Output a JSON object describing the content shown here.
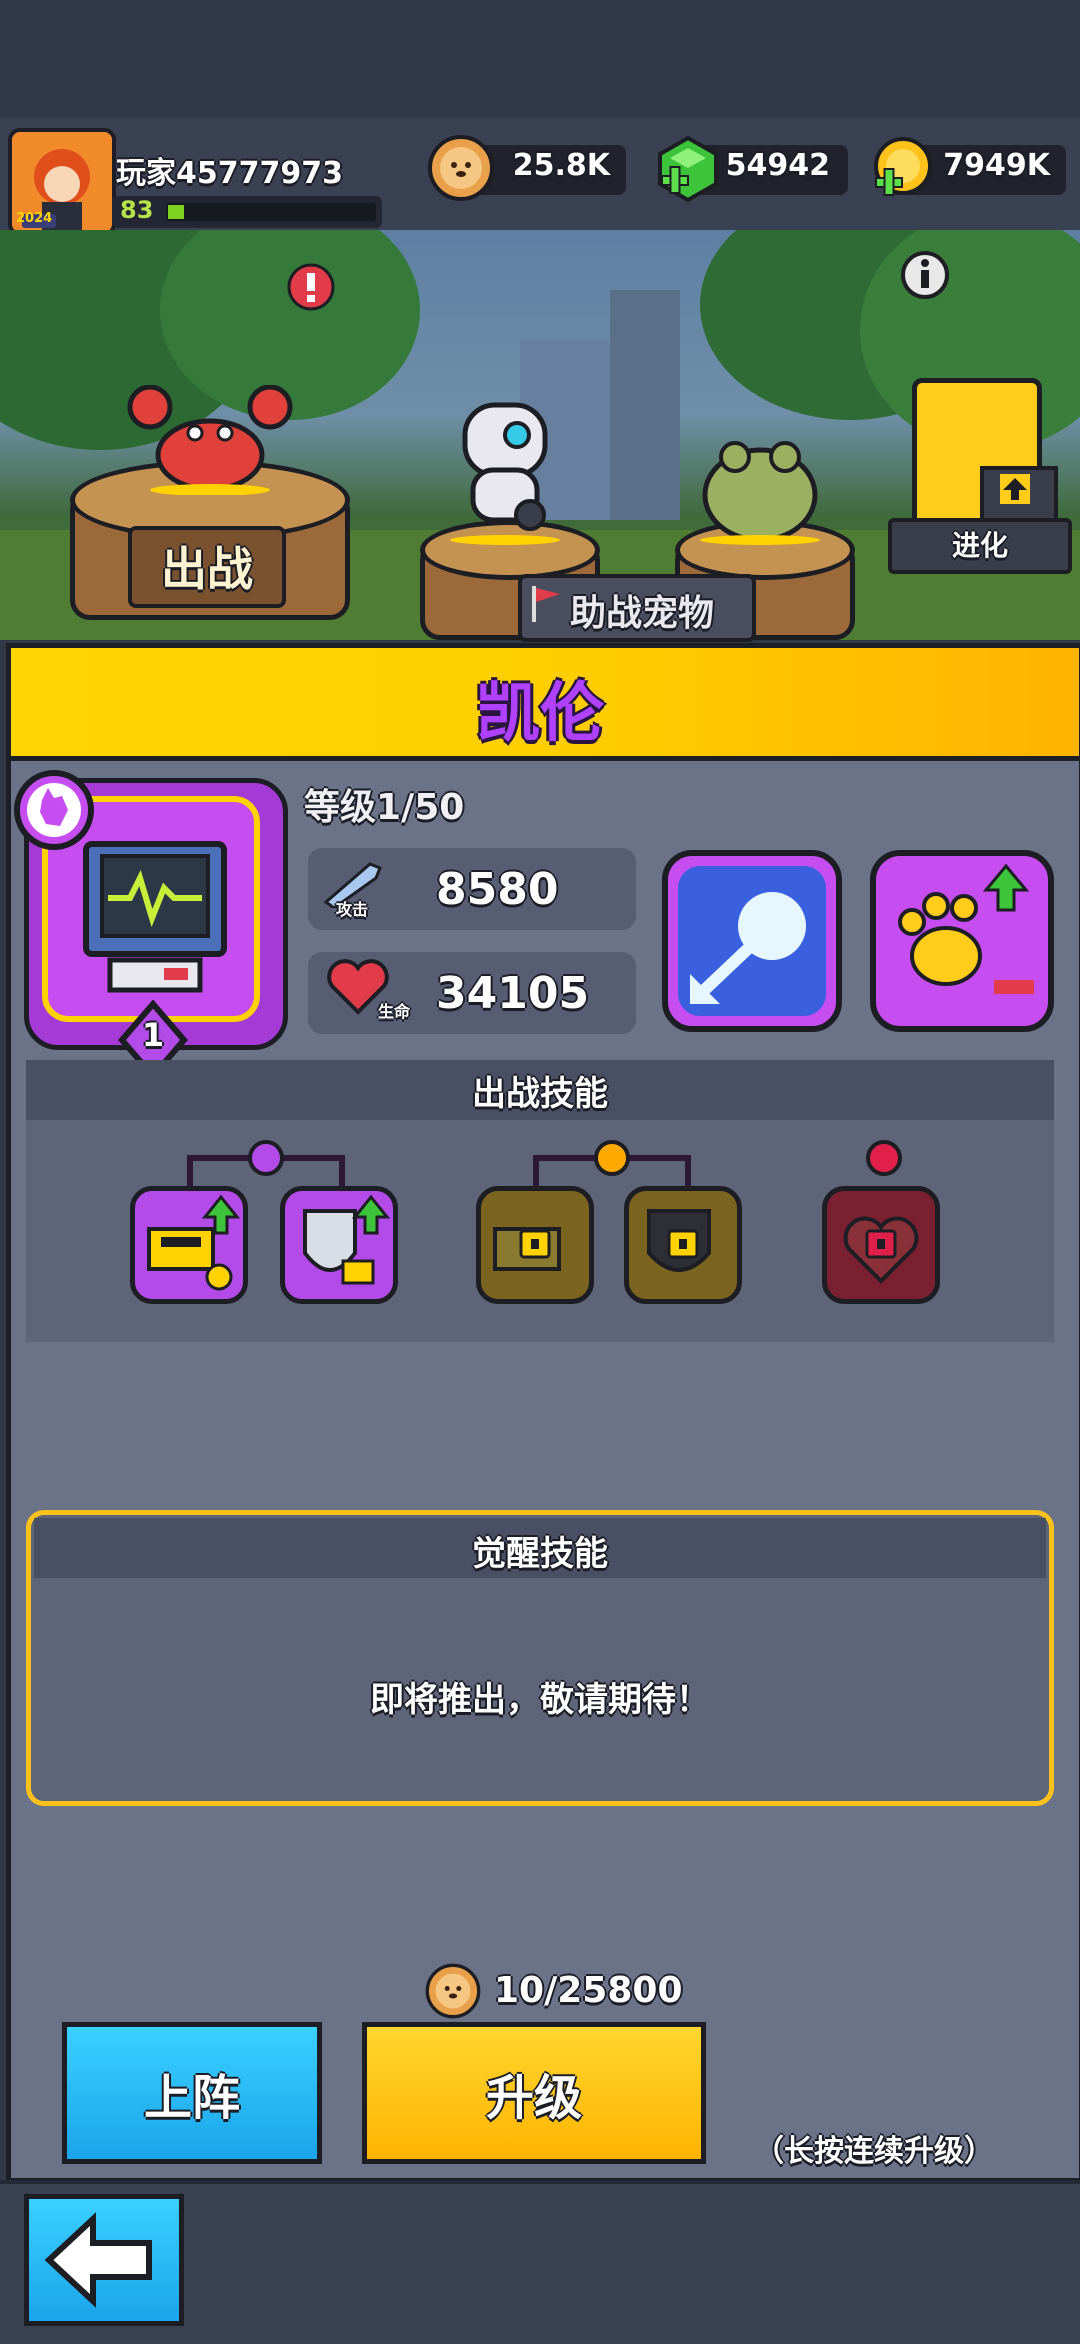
{
  "header": {
    "player_name": "玩家45777973",
    "player_level": "83",
    "avatar_year": "2024",
    "resources": [
      {
        "name": "dog-coin",
        "value": "25.8K"
      },
      {
        "name": "gem",
        "value": "54942"
      },
      {
        "name": "gold",
        "value": "7949K"
      }
    ],
    "level_progress": 0.08
  },
  "scene": {
    "battle_plate": "出战",
    "assist_label": "助战宠物",
    "evolve_label": "进化",
    "alert": "!",
    "info": "i"
  },
  "pet": {
    "name": "凯伦",
    "level_text": "等级1/50",
    "rank": "1",
    "attack_label": "攻击",
    "attack_value": "8580",
    "hp_label": "生命",
    "hp_value": "34105"
  },
  "battle_skills": {
    "title": "出战技能"
  },
  "awaken_skills": {
    "title": "觉醒技能",
    "message": "即将推出，敬请期待！"
  },
  "upgrade": {
    "cost": "10/25800",
    "deploy_label": "上阵",
    "upgrade_label": "升级",
    "hint": "（长按连续升级）"
  },
  "colors": {
    "title_bar": "#ffd400",
    "deploy_btn": "#22b8f5",
    "upgrade_btn": "#ffc400",
    "pet_card": "#c64df0"
  }
}
